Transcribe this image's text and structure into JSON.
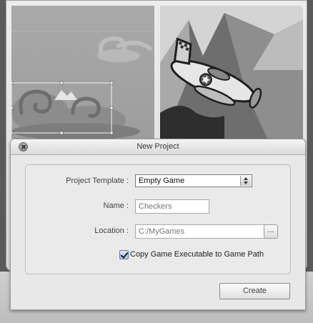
{
  "dialog": {
    "title": "New Project",
    "fields": {
      "template_label": "Project Template :",
      "template_value": "Empty Game",
      "name_label": "Name :",
      "name_value": "Checkers",
      "location_label": "Location :",
      "location_value": "C:/MyGames",
      "browse_label": "...",
      "copy_exe_label": "Copy Game Executable to Game Path",
      "copy_exe_checked": true
    },
    "create_label": "Create"
  },
  "icons": {
    "close": "close-circle-icon",
    "select_arrows": "up-down-arrows-icon",
    "checkmark": "checkmark-icon"
  },
  "colors": {
    "dialog_bg": "#e8e8e8",
    "checkbox_accent": "#a7c2e2"
  }
}
